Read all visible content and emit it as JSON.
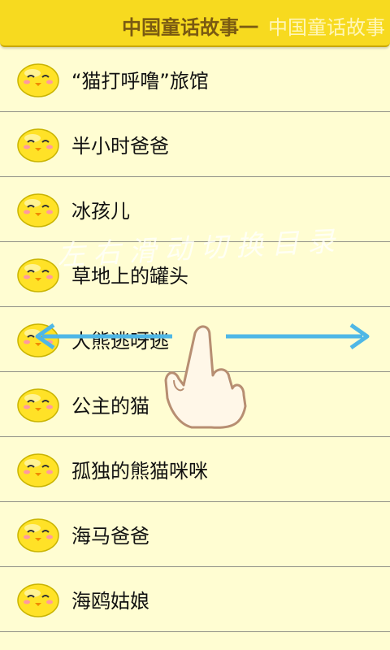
{
  "header": {
    "title": "中国童话故事一",
    "title_ghost": "中国童话故事"
  },
  "stories": [
    {
      "label": "“猫打呼噜”旅馆"
    },
    {
      "label": "半小时爸爸"
    },
    {
      "label": "冰孩儿"
    },
    {
      "label": "草地上的罐头"
    },
    {
      "label": "大熊逃呀逃"
    },
    {
      "label": "公主的猫"
    },
    {
      "label": "孤独的熊猫咪咪"
    },
    {
      "label": "海马爸爸"
    },
    {
      "label": "海鸥姑娘"
    }
  ],
  "overlay": {
    "watermark": "左右滑动切换目录",
    "swipe_hint": "hand-swipe-icon"
  },
  "colors": {
    "background": "#fffdd2",
    "header": "#f7da1f",
    "header_text": "#7a5a12",
    "divider": "#8f8f86",
    "arrow": "#4fb7e6"
  }
}
